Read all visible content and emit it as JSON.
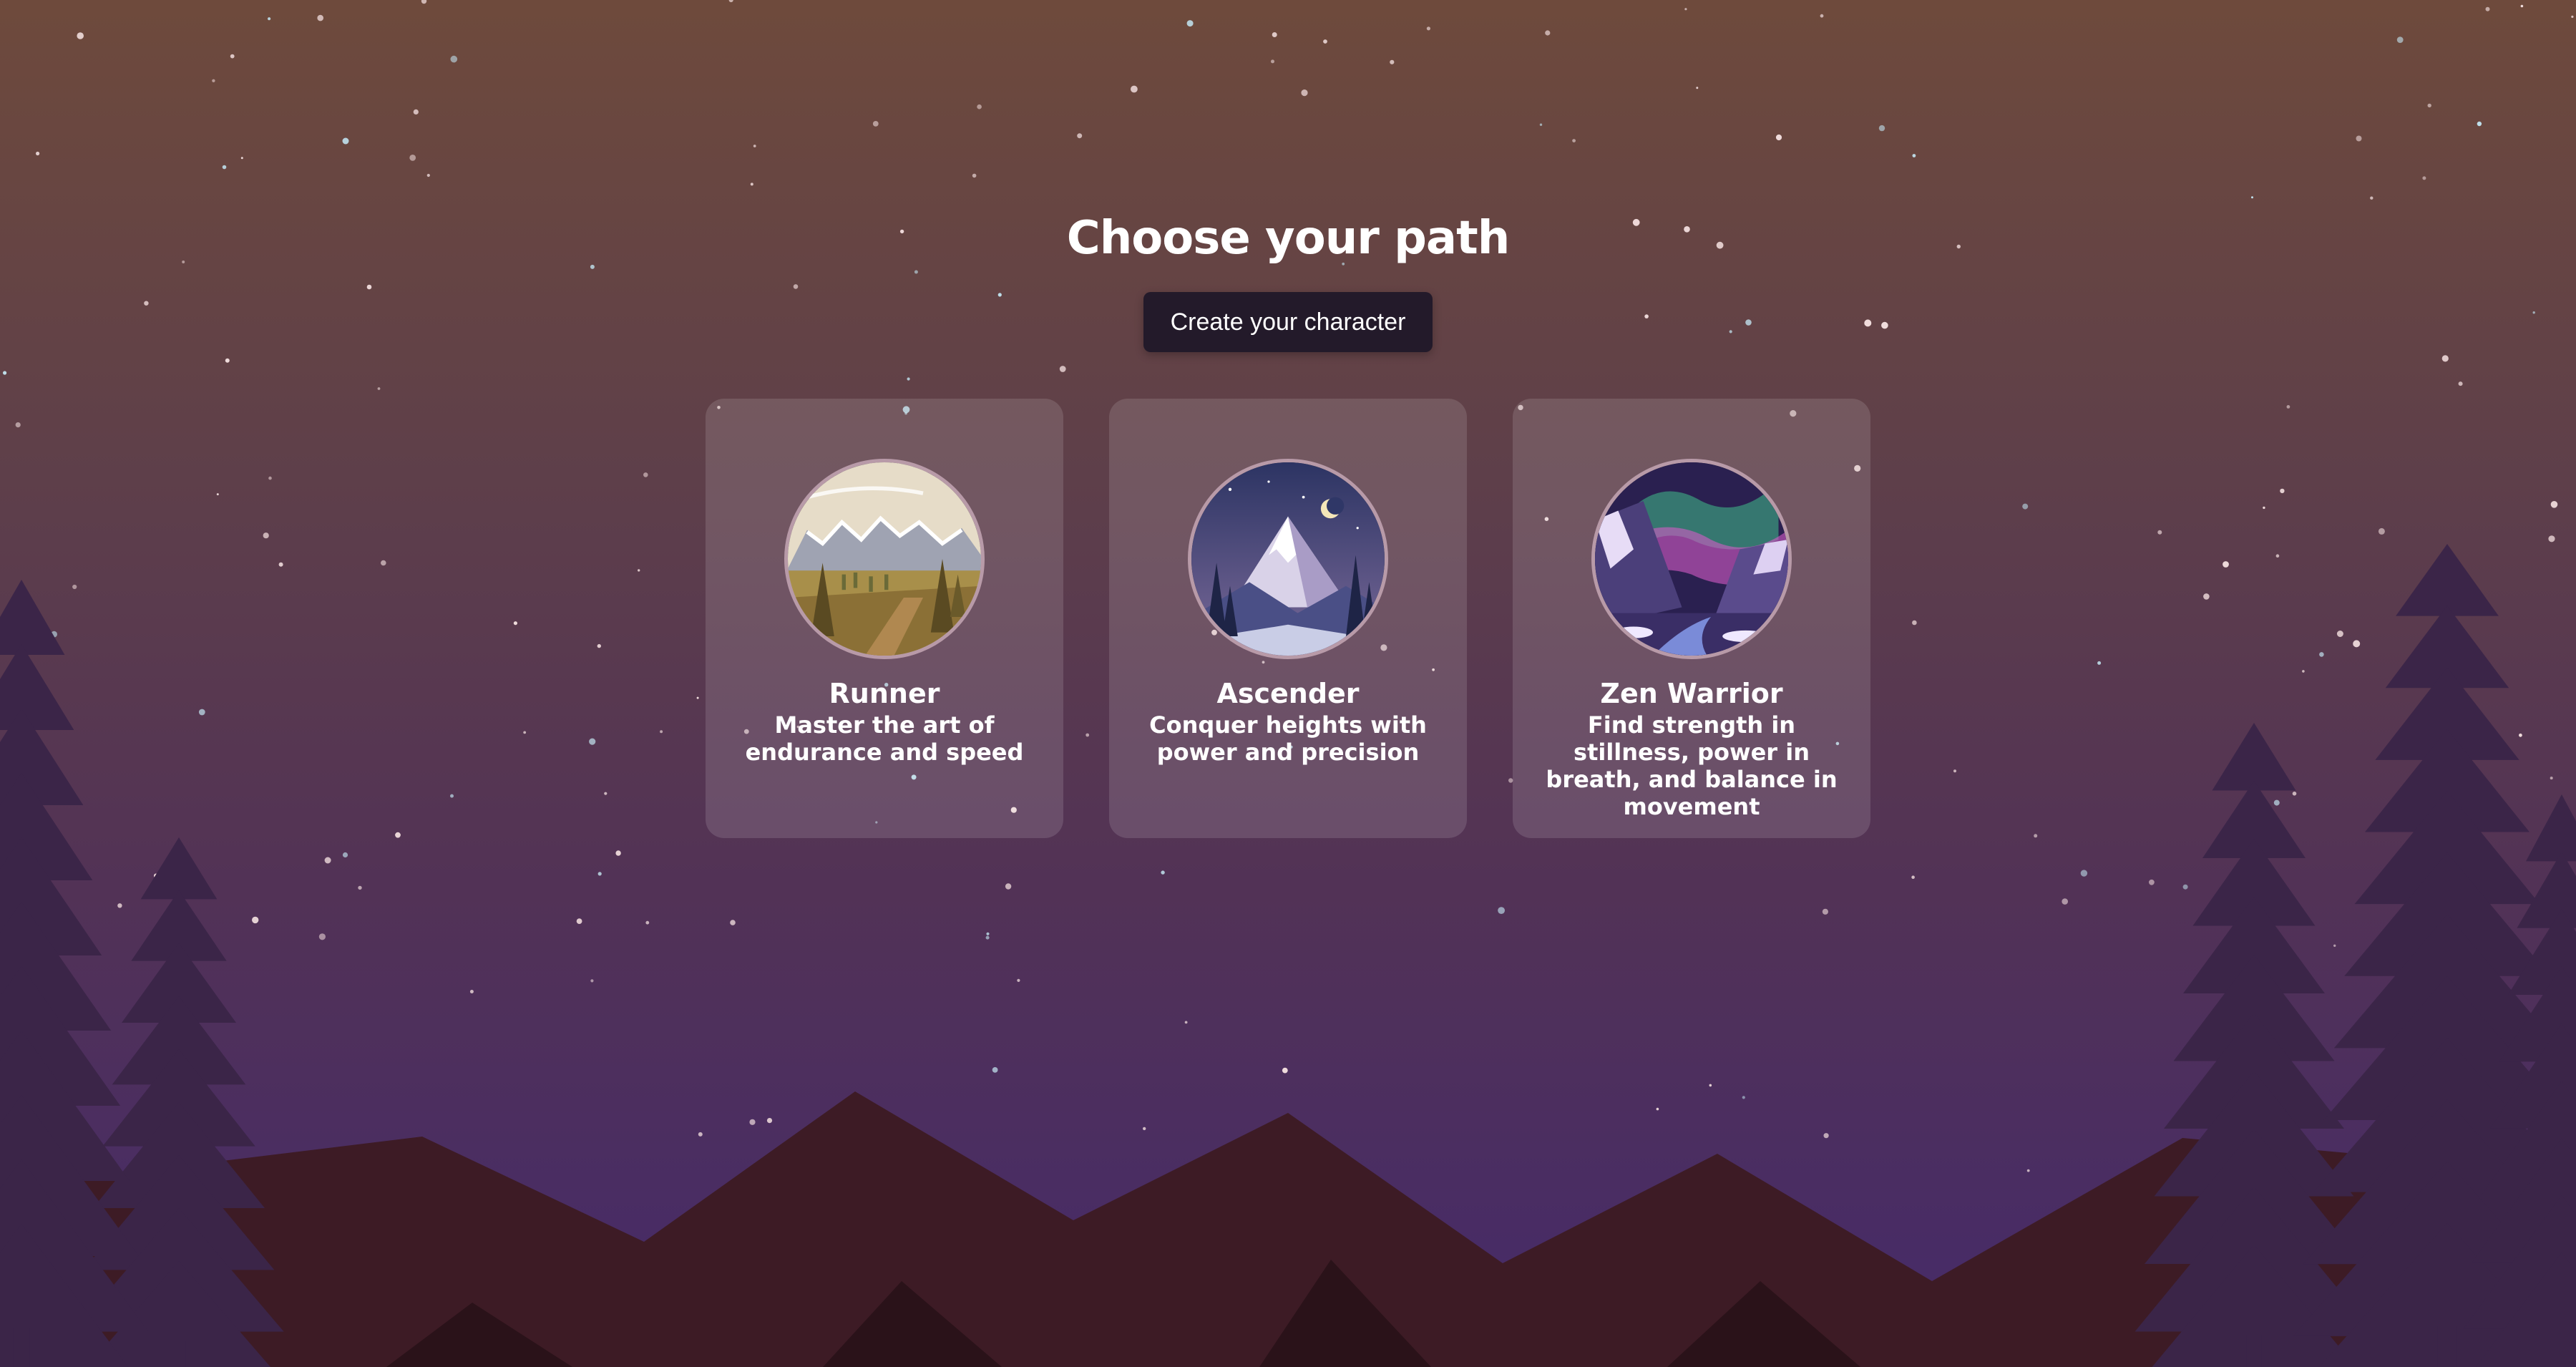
{
  "page": {
    "title": "Choose your path",
    "cta_label": "Create your character"
  },
  "paths": [
    {
      "name": "Runner",
      "description": "Master the art of endurance and speed",
      "emblem": "valley-landscape-icon"
    },
    {
      "name": "Ascender",
      "description": "Conquer heights with power and precision",
      "emblem": "mountain-peak-icon"
    },
    {
      "name": "Zen Warrior",
      "description": "Find strength in stillness, power in breath, and balance in movement",
      "emblem": "aurora-mountains-icon"
    }
  ],
  "colors": {
    "sky_top": "#6e4a3c",
    "sky_bottom": "#452a6a",
    "button": "#231a2a",
    "card_bg": "rgba(255,255,255,0.13)",
    "card_border": "#b89aa8",
    "mountains": "#3d1b25",
    "trees": "#3b2548"
  }
}
